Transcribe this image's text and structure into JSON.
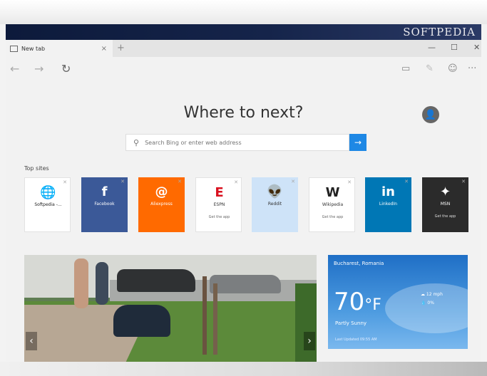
{
  "banner": {
    "brand": "SOFTPEDIA"
  },
  "tab": {
    "title": "New tab",
    "close": "×",
    "new": "+"
  },
  "window_controls": {
    "minimize": "—",
    "maximize": "☐",
    "close": "✕"
  },
  "nav": {
    "back": "←",
    "forward": "→",
    "refresh": "↻"
  },
  "toolbar": {
    "reading_view": "▭",
    "notes": "✎",
    "feedback": "☺",
    "more": "···"
  },
  "main": {
    "heading": "Where to next?",
    "avatar": "👤",
    "search_placeholder": "Search Bing or enter web address",
    "go": "→"
  },
  "top_sites": {
    "label": "Top sites",
    "tiles": [
      {
        "name": "Softpedia -...",
        "icon": "🌐",
        "sub": "",
        "bg": "#ffffff",
        "fg": "#222222",
        "iconcolor": "#222222"
      },
      {
        "name": "Facebook",
        "icon": "f",
        "sub": "",
        "bg": "#3b5998",
        "fg": "#ffffff",
        "iconcolor": "#ffffff"
      },
      {
        "name": "Aliexpress",
        "icon": "@",
        "sub": "",
        "bg": "#ff6a00",
        "fg": "#ffffff",
        "iconcolor": "#ffffff"
      },
      {
        "name": "ESPN",
        "icon": "E",
        "sub": "Get the app",
        "bg": "#ffffff",
        "fg": "#333333",
        "iconcolor": "#d9111f"
      },
      {
        "name": "Reddit",
        "icon": "👽",
        "sub": "",
        "bg": "#cee3f8",
        "fg": "#333333",
        "iconcolor": "#333333"
      },
      {
        "name": "Wikipedia",
        "icon": "W",
        "sub": "Get the app",
        "bg": "#ffffff",
        "fg": "#333333",
        "iconcolor": "#222222"
      },
      {
        "name": "LinkedIn",
        "icon": "in",
        "sub": "",
        "bg": "#0077b5",
        "fg": "#ffffff",
        "iconcolor": "#ffffff"
      },
      {
        "name": "MSN",
        "icon": "✦",
        "sub": "Get the app",
        "bg": "#2b2b2b",
        "fg": "#ffffff",
        "iconcolor": "#ffffff"
      }
    ]
  },
  "news": {
    "prev": "‹",
    "next": "›"
  },
  "weather": {
    "location": "Bucharest, Romania",
    "temp": "70",
    "unit": "°F",
    "condition": "Partly Sunny",
    "wind": "☁ 12 mph",
    "humidity": "💧 0%",
    "updated": "Last Updated 09:55 AM"
  }
}
